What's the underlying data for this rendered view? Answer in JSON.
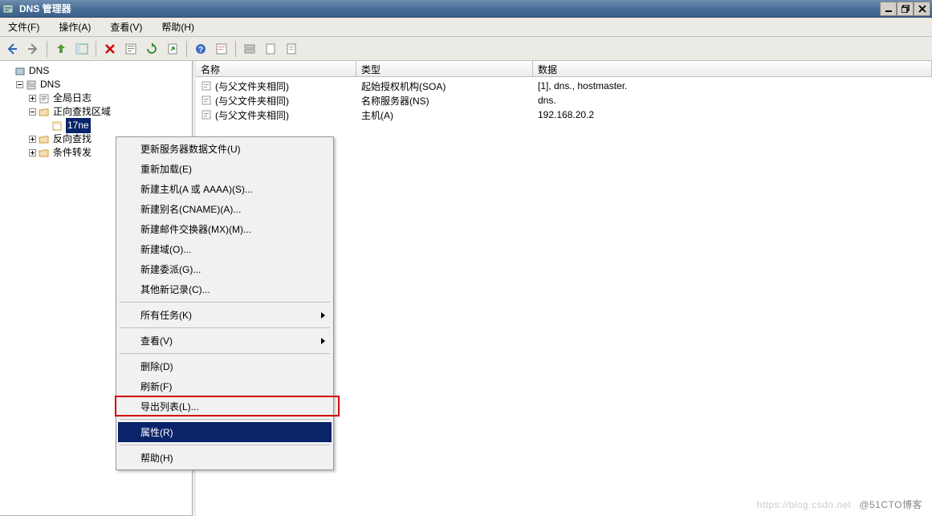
{
  "window": {
    "title": "DNS 管理器"
  },
  "menus": {
    "file": "文件(F)",
    "action": "操作(A)",
    "view": "查看(V)",
    "help": "帮助(H)"
  },
  "tree": {
    "root": "DNS",
    "server": "DNS",
    "global_log": "全局日志",
    "fwd_zone": "正向查找区域",
    "selected_zone": "17ne",
    "rev_zone": "反向查找",
    "cond_fwd": "条件转发"
  },
  "columns": {
    "name": "名称",
    "type": "类型",
    "data": "数据"
  },
  "rows": [
    {
      "name": "(与父文件夹相同)",
      "type": "起始授权机构(SOA)",
      "data": "[1], dns., hostmaster."
    },
    {
      "name": "(与父文件夹相同)",
      "type": "名称服务器(NS)",
      "data": "dns."
    },
    {
      "name": "(与父文件夹相同)",
      "type": "主机(A)",
      "data": "192.168.20.2"
    }
  ],
  "context_menu": {
    "update_data": "更新服务器数据文件(U)",
    "reload": "重新加载(E)",
    "new_host": "新建主机(A 或 AAAA)(S)...",
    "new_cname": "新建别名(CNAME)(A)...",
    "new_mx": "新建邮件交换器(MX)(M)...",
    "new_domain": "新建域(O)...",
    "new_delegation": "新建委派(G)...",
    "other_new": "其他新记录(C)...",
    "all_tasks": "所有任务(K)",
    "view": "查看(V)",
    "delete": "删除(D)",
    "refresh": "刷新(F)",
    "export_list": "导出列表(L)...",
    "properties": "属性(R)",
    "help": "帮助(H)"
  },
  "watermark": {
    "faint": "https://blog.csdn.net",
    "text": "@51CTO博客"
  }
}
